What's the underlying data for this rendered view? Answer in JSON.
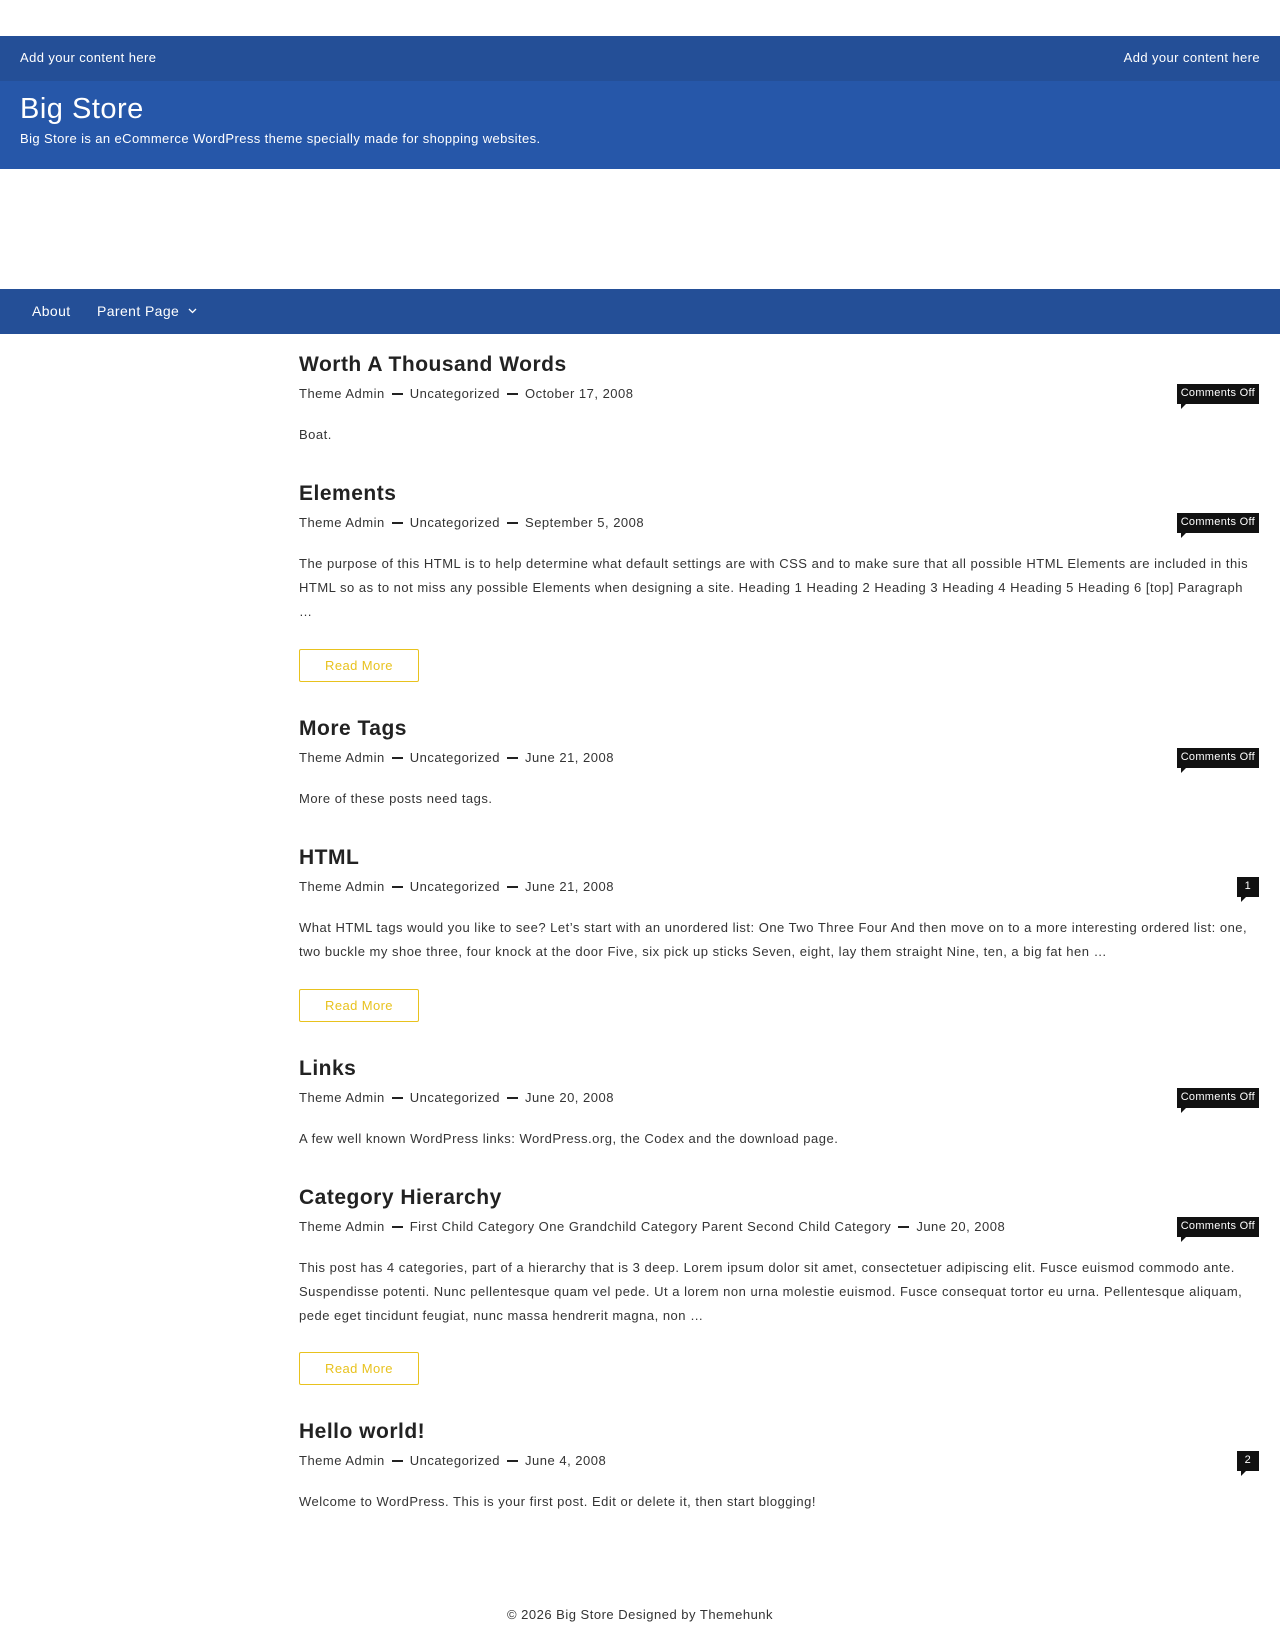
{
  "topbar": {
    "left_text": "Add your content here",
    "right_text": "Add your content here",
    "bg_color": "#244f97"
  },
  "header": {
    "site_title": "Big Store",
    "tagline": "Big Store is an eCommerce WordPress theme specially made for shopping websites.",
    "bg_color": "#2657a9"
  },
  "nav": {
    "items": [
      {
        "label": "About"
      },
      {
        "label": "Parent Page",
        "icon": "chevron-down-icon"
      }
    ]
  },
  "posts": [
    {
      "title": "Worth A Thousand Words",
      "author": "Theme Admin",
      "category": "Uncategorized",
      "date": "October 17, 2008",
      "comments": "Comments Off",
      "excerpt": "Boat."
    },
    {
      "title": "Elements",
      "author": "Theme Admin",
      "category": "Uncategorized",
      "date": "September 5, 2008",
      "comments": "Comments Off",
      "excerpt": "The purpose of this HTML is to help determine what default settings are with CSS and to make sure that all possible HTML Elements are included in this HTML so as to not miss any possible Elements when designing a site. Heading 1 Heading 2 Heading 3 Heading 4 Heading 5 Heading 6 [top] Paragraph …",
      "read_more": "Read More"
    },
    {
      "title": "More Tags",
      "author": "Theme Admin",
      "category": "Uncategorized",
      "date": "June 21, 2008",
      "comments": "Comments Off",
      "excerpt": "More of these posts need tags."
    },
    {
      "title": "HTML",
      "author": "Theme Admin",
      "category": "Uncategorized",
      "date": "June 21, 2008",
      "comments": "1",
      "excerpt": "What HTML tags would you like to see? Let’s start with an unordered list: One Two Three Four And then move on to a more interesting ordered list: one, two buckle my shoe three, four knock at the door Five, six pick up sticks Seven, eight, lay them straight Nine, ten, a big fat hen …",
      "read_more": "Read More"
    },
    {
      "title": "Links",
      "author": "Theme Admin",
      "category": "Uncategorized",
      "date": "June 20, 2008",
      "comments": "Comments Off",
      "excerpt": "A few well known WordPress links: WordPress.org, the Codex and the download page."
    },
    {
      "title": "Category Hierarchy",
      "author": "Theme Admin",
      "category": "First Child Category One Grandchild Category Parent Second Child Category",
      "date": "June 20, 2008",
      "comments": "Comments Off",
      "excerpt": "This post has 4 categories, part of a hierarchy that is 3 deep. Lorem ipsum dolor sit amet, consectetuer adipiscing elit. Fusce euismod commodo ante. Suspendisse potenti. Nunc pellentesque quam vel pede. Ut a lorem non urna molestie euismod. Fusce consequat tortor eu urna. Pellentesque aliquam, pede eget tincidunt feugiat, nunc massa hendrerit magna, non …",
      "read_more": "Read More"
    },
    {
      "title": "Hello world!",
      "author": "Theme Admin",
      "category": "Uncategorized",
      "date": "June 4, 2008",
      "comments": "2",
      "excerpt": "Welcome to WordPress. This is your first post. Edit or delete it, then start blogging!"
    }
  ],
  "footer": {
    "text": "© 2026 Big Store Designed by Themehunk"
  },
  "colors": {
    "accent_button": "#e8c21e",
    "badge_bg": "#111111"
  }
}
